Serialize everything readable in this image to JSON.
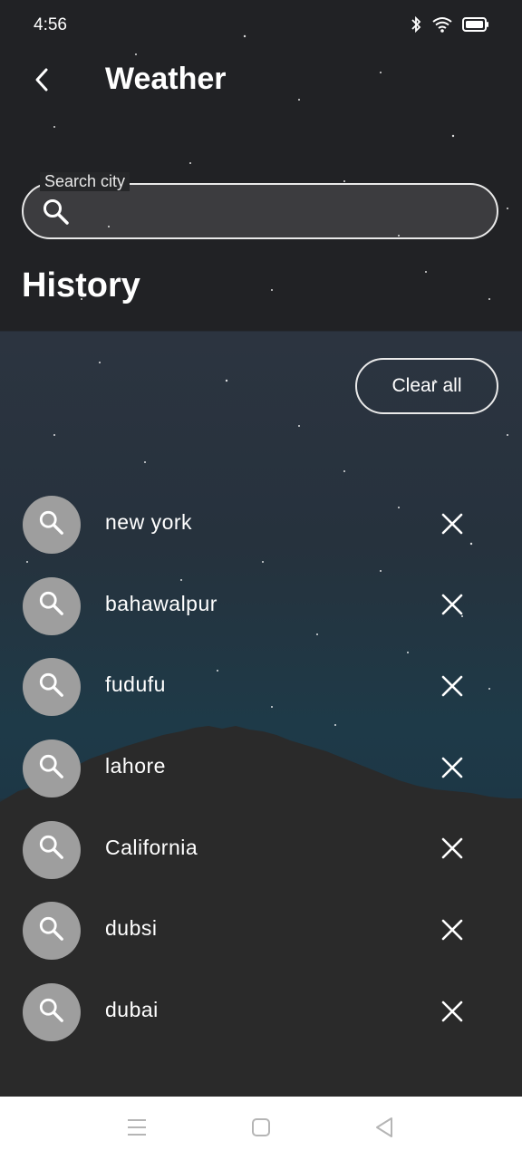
{
  "status_bar": {
    "time": "4:56",
    "icons": [
      "bluetooth-icon",
      "wifi-icon",
      "battery-icon"
    ]
  },
  "app_bar": {
    "back_icon": "chevron-left-icon",
    "title": "Weather"
  },
  "search": {
    "label": "Search city",
    "value": "",
    "icon": "search-icon"
  },
  "history": {
    "title": "History",
    "clear_all_label": "Clear all",
    "items": [
      {
        "label": "new york"
      },
      {
        "label": "bahawalpur"
      },
      {
        "label": "fudufu"
      },
      {
        "label": "lahore"
      },
      {
        "label": "California"
      },
      {
        "label": "dubsi"
      },
      {
        "label": "dubai"
      }
    ]
  },
  "nav_bar": {
    "buttons": [
      "menu-icon",
      "home-square-icon",
      "back-triangle-icon"
    ]
  },
  "colors": {
    "avatar_bg": "#9e9e9e",
    "border": "#eaeaea",
    "background": "#2a2a2a"
  }
}
